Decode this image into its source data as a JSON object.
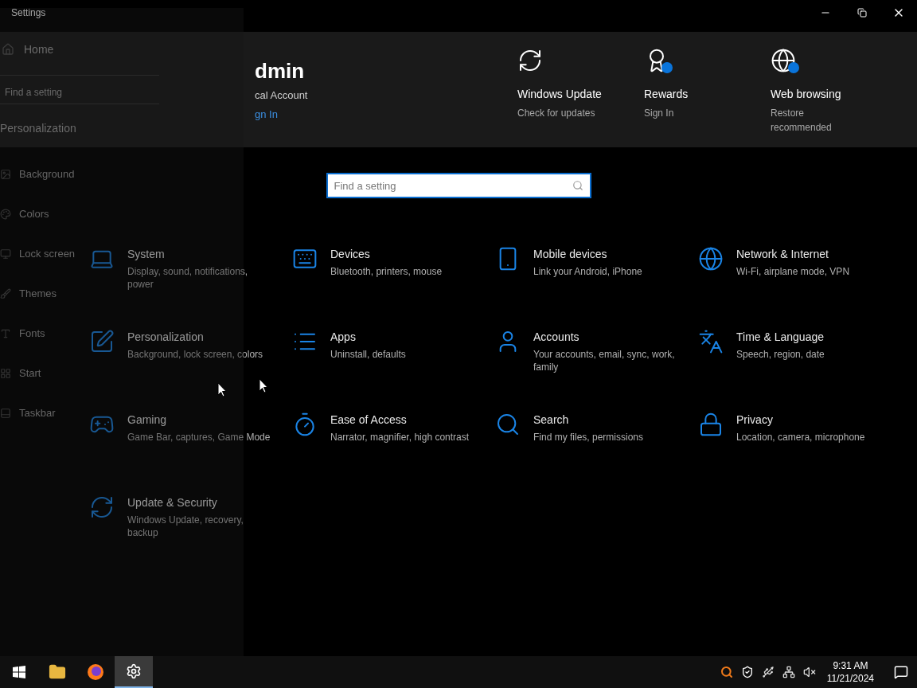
{
  "window": {
    "title": "Settings"
  },
  "account": {
    "name": "dmin",
    "type": "cal Account",
    "link": "gn In"
  },
  "header_items": [
    {
      "title": "Windows Update",
      "subtitle": "Check for updates",
      "badge": false
    },
    {
      "title": "Rewards",
      "subtitle": "Sign In",
      "badge": true
    },
    {
      "title": "Web browsing",
      "subtitle": "Restore recommended",
      "badge": true
    }
  ],
  "search": {
    "placeholder": "Find a setting"
  },
  "categories": [
    {
      "title": "System",
      "subtitle": "Display, sound, notifications, power"
    },
    {
      "title": "Devices",
      "subtitle": "Bluetooth, printers, mouse"
    },
    {
      "title": "Mobile devices",
      "subtitle": "Link your Android, iPhone"
    },
    {
      "title": "Network & Internet",
      "subtitle": "Wi-Fi, airplane mode, VPN"
    },
    {
      "title": "Personalization",
      "subtitle": "Background, lock screen, colors"
    },
    {
      "title": "Apps",
      "subtitle": "Uninstall, defaults"
    },
    {
      "title": "Accounts",
      "subtitle": "Your accounts, email, sync, work, family"
    },
    {
      "title": "Time & Language",
      "subtitle": "Speech, region, date"
    },
    {
      "title": "Gaming",
      "subtitle": "Game Bar, captures, Game Mode"
    },
    {
      "title": "Ease of Access",
      "subtitle": "Narrator, magnifier, high contrast"
    },
    {
      "title": "Search",
      "subtitle": "Find my files, permissions"
    },
    {
      "title": "Privacy",
      "subtitle": "Location, camera, microphone"
    },
    {
      "title": "Update & Security",
      "subtitle": "Windows Update, recovery, backup"
    }
  ],
  "overlay": {
    "home": "Home",
    "search_placeholder": "Find a setting",
    "heading": "Personalization",
    "items": [
      {
        "label": "Background"
      },
      {
        "label": "Colors"
      },
      {
        "label": "Lock screen"
      },
      {
        "label": "Themes"
      },
      {
        "label": "Fonts"
      },
      {
        "label": "Start"
      },
      {
        "label": "Taskbar"
      }
    ]
  },
  "taskbar": {
    "apps": [
      {
        "selected": false
      },
      {
        "selected": false
      },
      {
        "selected": true
      }
    ],
    "time": "9:31 AM",
    "date": "11/21/2024"
  }
}
